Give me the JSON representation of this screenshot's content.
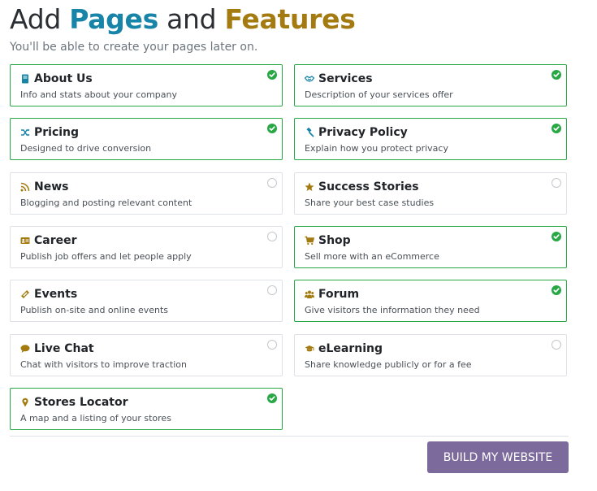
{
  "header": {
    "title_word1": "Add",
    "title_word2": "Pages",
    "title_word3": "and",
    "title_word4": "Features",
    "subtitle": "You'll be able to create your pages later on."
  },
  "colors": {
    "title_accent_1": "#1784a8",
    "title_accent_2": "#a47b11",
    "selected_border": "#28a745",
    "check_green": "#28a745",
    "icon_teal": "#1784a8",
    "icon_gold": "#a47b11",
    "primary_button": "#7b6a9b"
  },
  "features": [
    {
      "name": "About Us",
      "description": "Info and stats about your company",
      "icon": "book-icon",
      "selected": true
    },
    {
      "name": "Services",
      "description": "Description of your services offer",
      "icon": "handshake-icon",
      "selected": true
    },
    {
      "name": "Pricing",
      "description": "Designed to drive conversion",
      "icon": "random-icon",
      "selected": true
    },
    {
      "name": "Privacy Policy",
      "description": "Explain how you protect privacy",
      "icon": "gavel-icon",
      "selected": true
    },
    {
      "name": "News",
      "description": "Blogging and posting relevant content",
      "icon": "rss-icon",
      "selected": false
    },
    {
      "name": "Success Stories",
      "description": "Share your best case studies",
      "icon": "star-icon",
      "selected": false
    },
    {
      "name": "Career",
      "description": "Publish job offers and let people apply",
      "icon": "id-card-icon",
      "selected": false
    },
    {
      "name": "Shop",
      "description": "Sell more with an eCommerce",
      "icon": "cart-icon",
      "selected": true
    },
    {
      "name": "Events",
      "description": "Publish on-site and online events",
      "icon": "ticket-icon",
      "selected": false
    },
    {
      "name": "Forum",
      "description": "Give visitors the information they need",
      "icon": "users-icon",
      "selected": true
    },
    {
      "name": "Live Chat",
      "description": "Chat with visitors to improve traction",
      "icon": "comment-icon",
      "selected": false
    },
    {
      "name": "eLearning",
      "description": "Share knowledge publicly or for a fee",
      "icon": "graduation-cap-icon",
      "selected": false
    },
    {
      "name": "Stores Locator",
      "description": "A map and a listing of your stores",
      "icon": "map-marker-icon",
      "selected": true
    }
  ],
  "footer": {
    "build_button_label": "BUILD MY WEBSITE"
  }
}
